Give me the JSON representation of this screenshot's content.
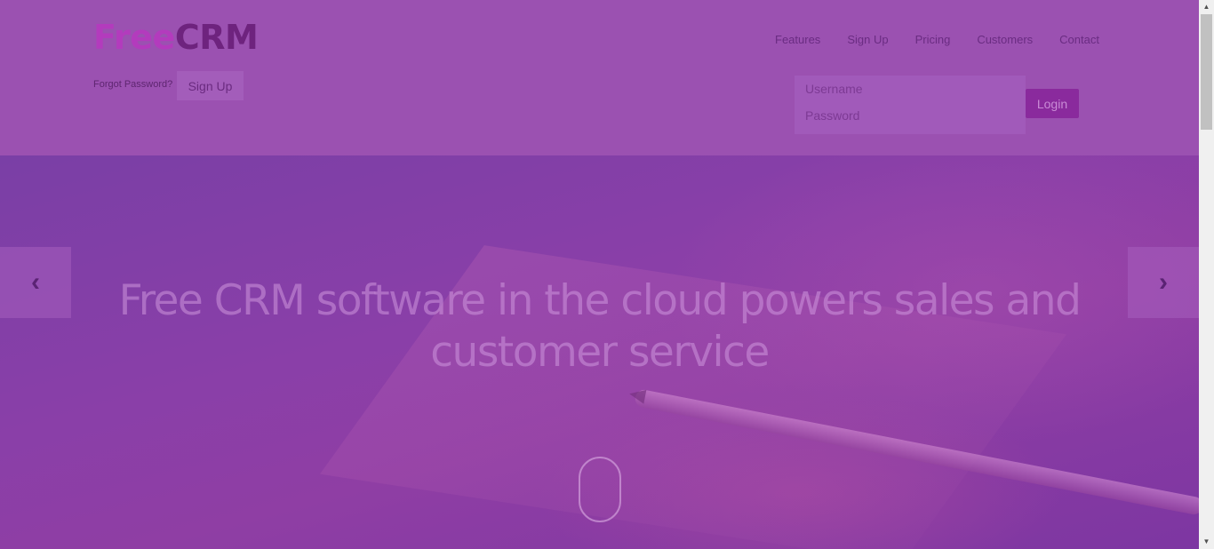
{
  "header": {
    "logo_part1": "Free",
    "logo_part2": "CRM",
    "nav": [
      "Features",
      "Sign Up",
      "Pricing",
      "Customers",
      "Contact"
    ],
    "forgot_password": "Forgot Password?",
    "signup_button": "Sign Up",
    "login": {
      "username_placeholder": "Username",
      "password_placeholder": "Password",
      "login_button": "Login"
    }
  },
  "hero": {
    "headline": "Free CRM software in the cloud powers sales and customer service",
    "prev_arrow": "‹",
    "next_arrow": "›"
  },
  "scrollbar": {
    "up_arrow": "▲",
    "down_arrow": "▼"
  }
}
